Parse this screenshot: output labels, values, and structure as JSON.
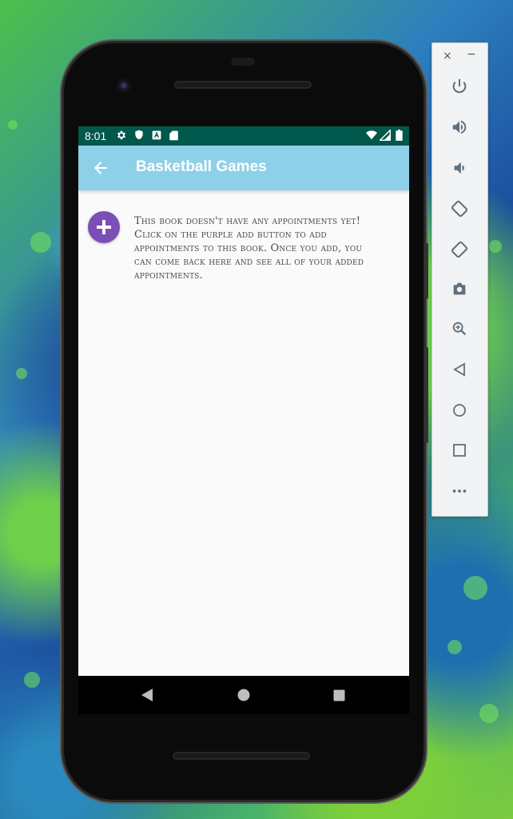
{
  "status_bar": {
    "time": "8:01",
    "icons": [
      "gear-icon",
      "shield-icon",
      "a-icon",
      "sd-card-icon",
      "wifi-icon",
      "signal-icon",
      "battery-icon"
    ]
  },
  "app_bar": {
    "title": "Basketball Games",
    "back_icon": "back-arrow-icon"
  },
  "content": {
    "add_button_icon": "plus-icon",
    "empty_message": "This book doesn't have any appointments yet! Click on the purple add button to add appointments to this book. Once you add, you can come back here and see all of your added appointments."
  },
  "nav_bar": {
    "buttons": [
      "back-triangle-icon",
      "home-circle-icon",
      "recents-square-icon"
    ]
  },
  "emulator_panel": {
    "close_label": "×",
    "minimize_label": "−",
    "tools": [
      "power-icon",
      "volume-up-icon",
      "volume-down-icon",
      "rotate-left-icon",
      "rotate-right-icon",
      "camera-icon",
      "zoom-icon",
      "back-icon",
      "home-icon",
      "overview-icon",
      "more-icon"
    ]
  },
  "colors": {
    "status_bar": "#00574b",
    "app_bar": "#8ed0e8",
    "add_button": "#7b4fb5",
    "screen_bg": "#fafafa"
  }
}
